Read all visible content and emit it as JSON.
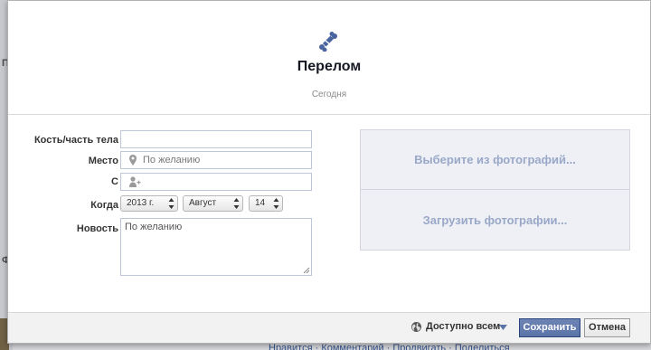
{
  "background": {
    "side_letters": [
      "П",
      "Ф"
    ],
    "bottom_links": "Нравится · Комментарий · Продвигать · Поделиться"
  },
  "dialog": {
    "icon": "bone-icon",
    "title": "Перелом",
    "subtitle": "Сегодня",
    "form": {
      "bone_label": "Кость/часть тела",
      "bone_value": "",
      "place_label": "Место",
      "place_placeholder": "По желанию",
      "with_label": "С",
      "with_value": "",
      "when_label": "Когда",
      "year": "2013 г.",
      "month": "Август",
      "day": "14",
      "news_label": "Новость",
      "news_placeholder": "По желанию"
    },
    "photos": {
      "choose": "Выберите из фотографий...",
      "upload": "Загрузить фотографии..."
    },
    "footer": {
      "privacy": "Доступно всем",
      "save": "Сохранить",
      "cancel": "Отмена"
    }
  },
  "colors": {
    "accent": "#5b74a8",
    "photo_text": "#9aa8c8",
    "icon_blue": "#4a64a0"
  }
}
